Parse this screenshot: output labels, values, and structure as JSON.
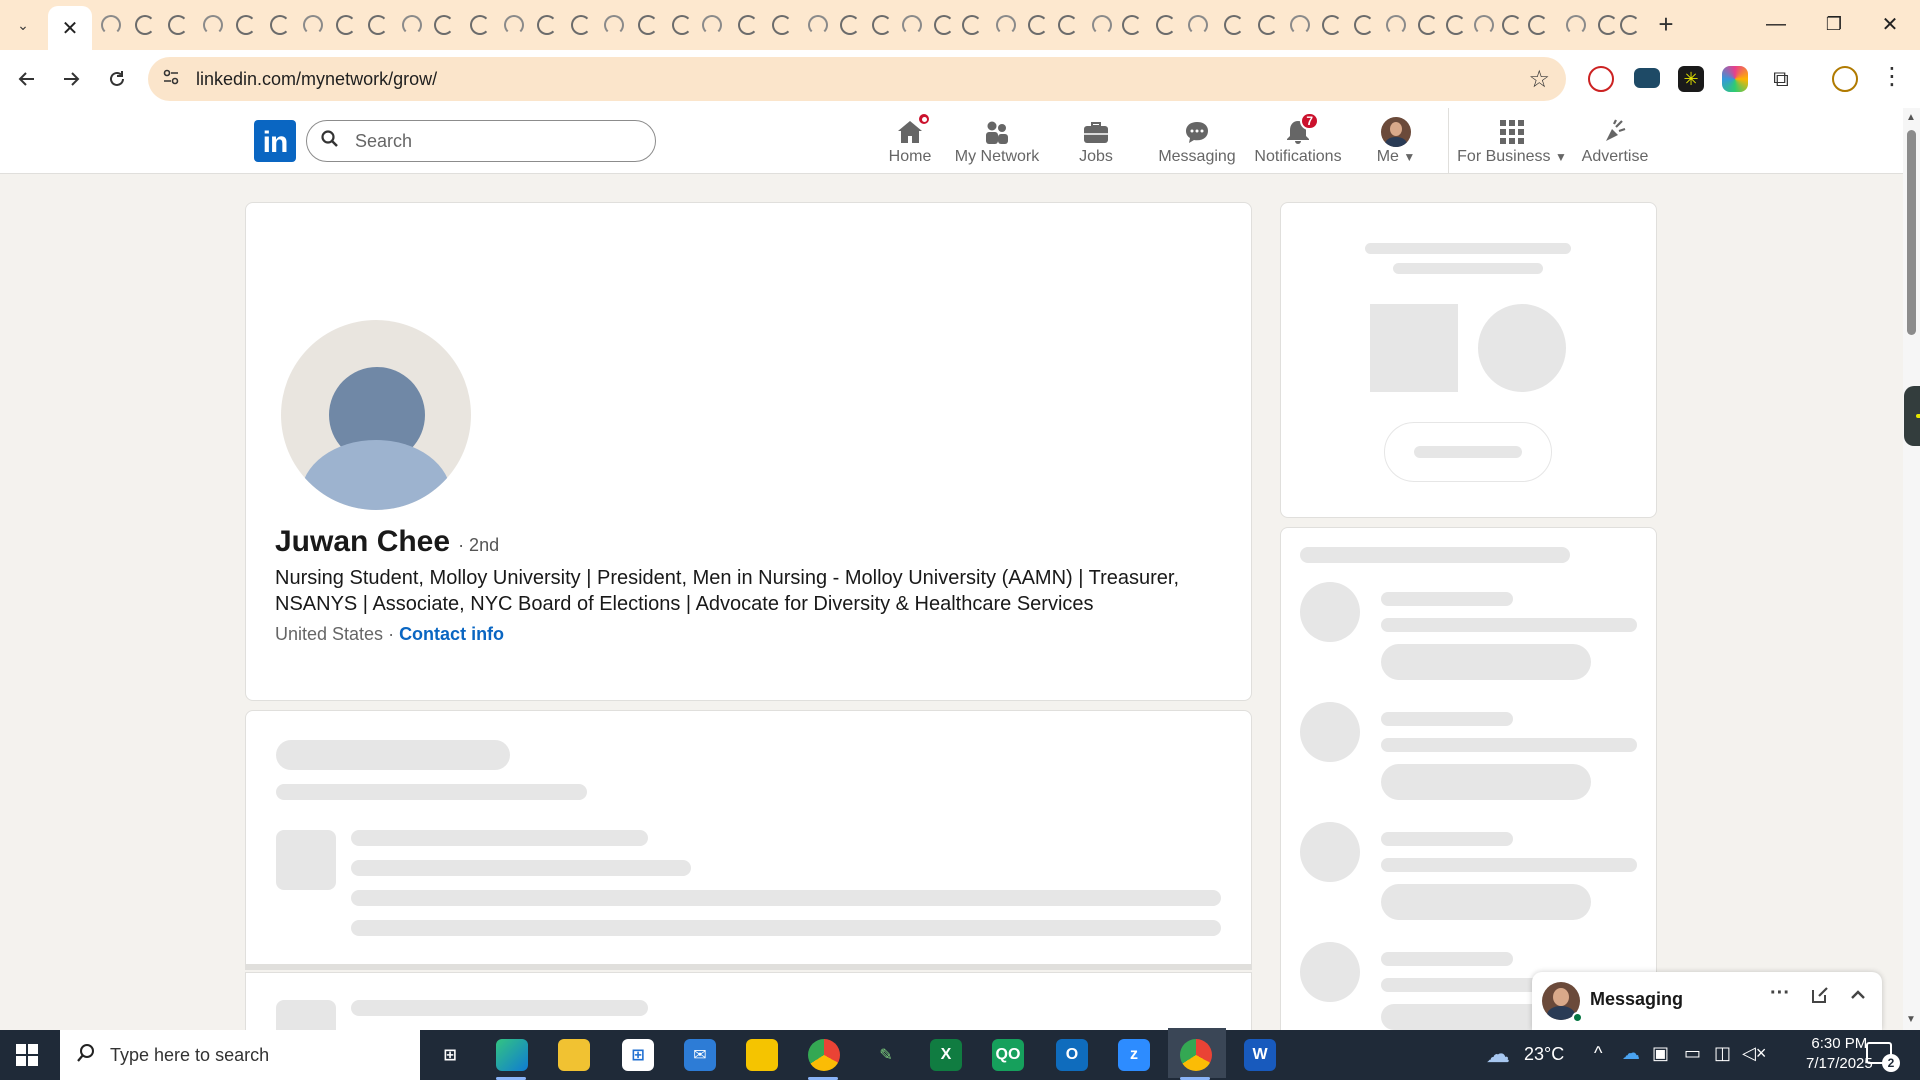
{
  "browser": {
    "url": "linkedin.com/mynetwork/grow/",
    "tab_close_label": "✕",
    "new_tab_label": "+",
    "window_controls": {
      "minimize": "—",
      "maximize": "❐",
      "close": "✕"
    }
  },
  "linkedin": {
    "logo_text": "in",
    "search_placeholder": "Search",
    "nav": {
      "home": "Home",
      "my_network": "My Network",
      "jobs": "Jobs",
      "messaging": "Messaging",
      "notifications": "Notifications",
      "notifications_count": "7",
      "me": "Me",
      "for_business": "For Business",
      "advertise": "Advertise"
    },
    "brand_color": "#0a66c2",
    "badge_color": "#cb112d"
  },
  "profile": {
    "name": "Juwan Chee",
    "degree": "· 2nd",
    "headline": "Nursing Student, Molloy University | President, Men in Nursing - Molloy University (AAMN) | Treasurer, NSANYS | Associate, NYC Board of Elections | Advocate for Diversity & Healthcare Services",
    "location": "United States",
    "separator": " · ",
    "contact_info": "Contact info"
  },
  "messaging_widget": {
    "title": "Messaging",
    "more": "···"
  },
  "taskbar": {
    "search_placeholder": "Type here to search",
    "temperature": "23°C",
    "time": "6:30 PM",
    "date": "7/17/2025",
    "notification_count": "2"
  }
}
